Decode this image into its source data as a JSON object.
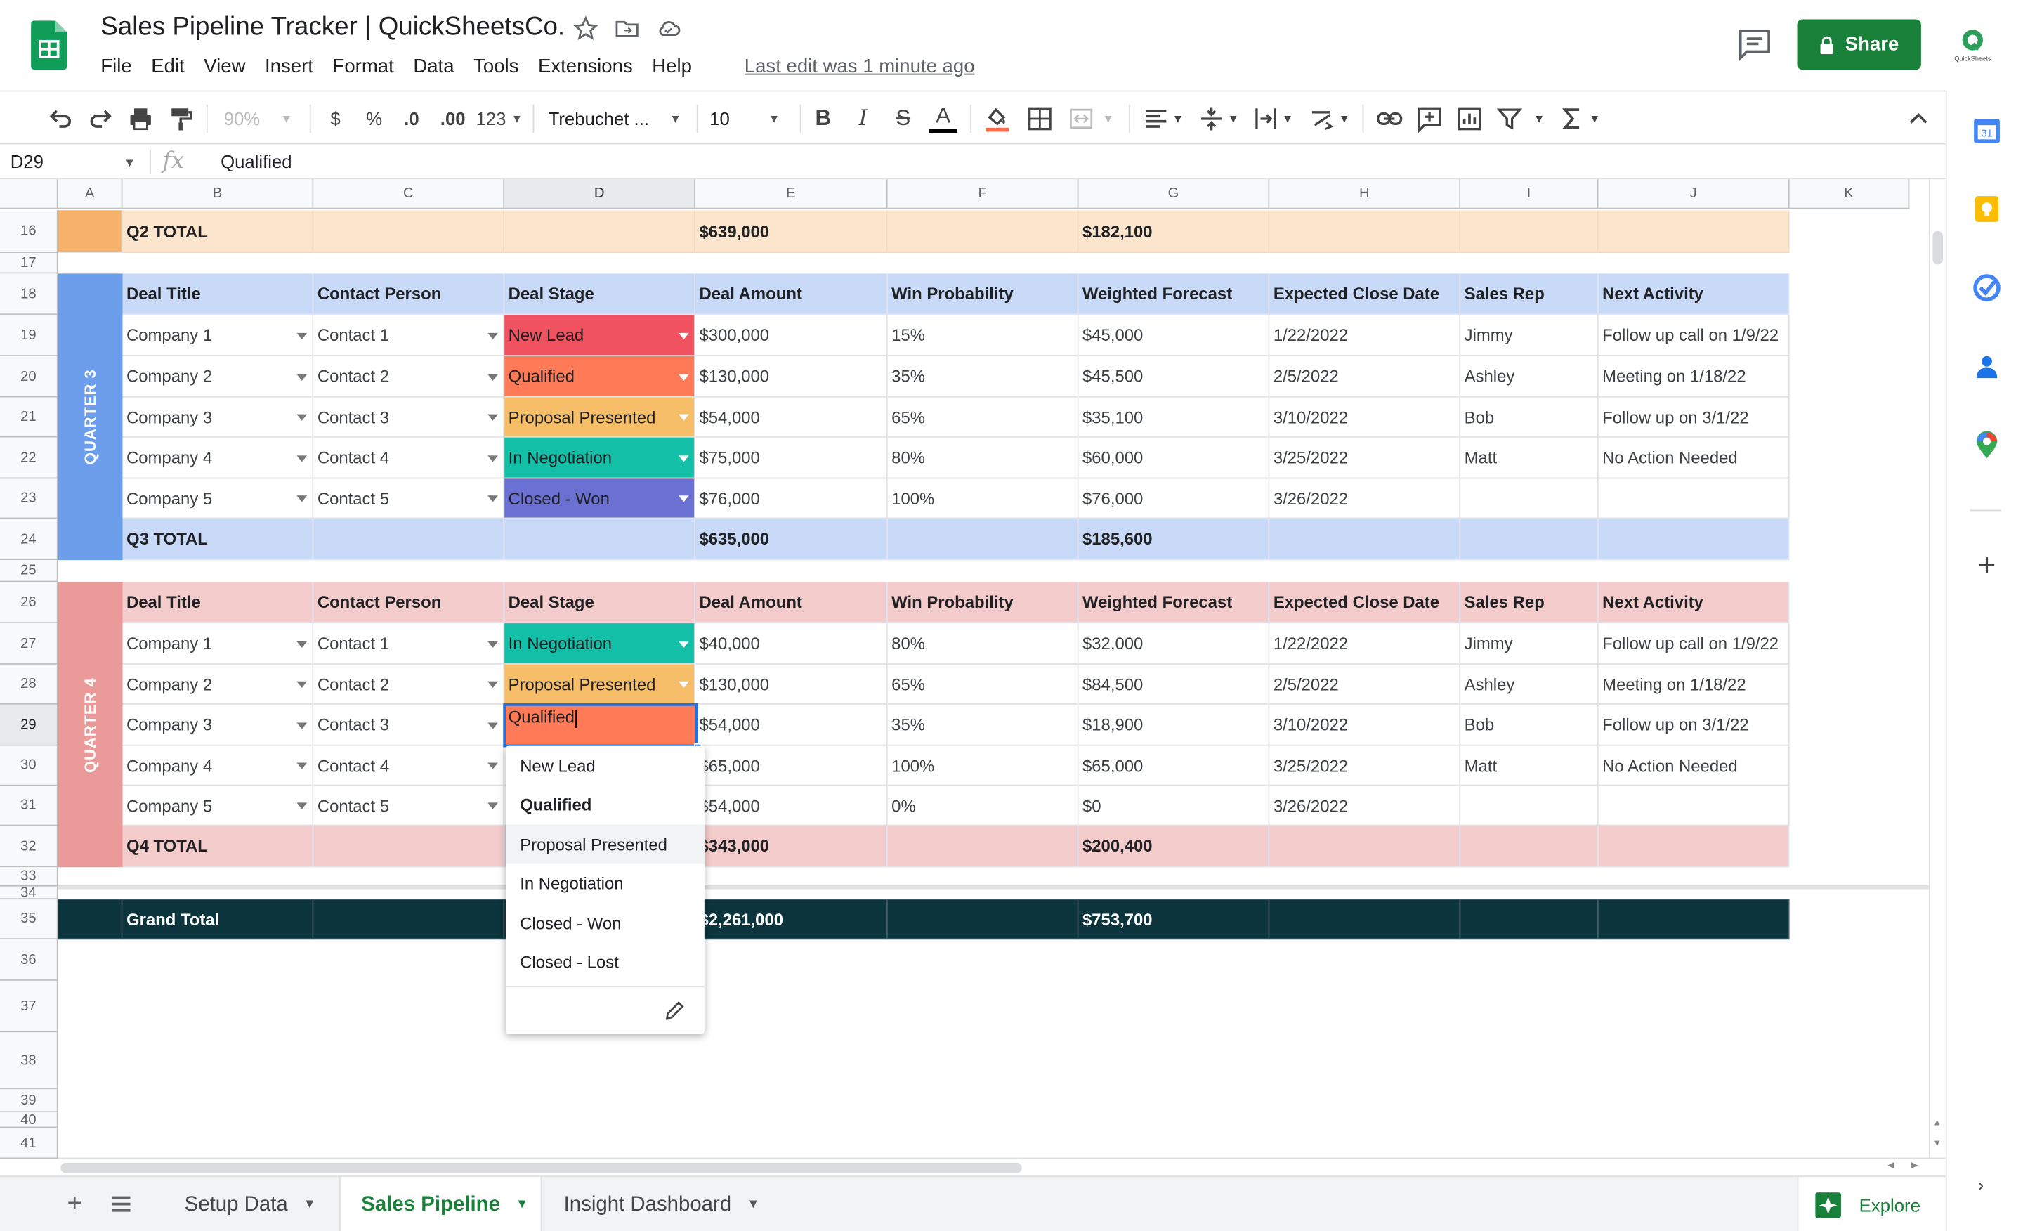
{
  "header": {
    "title": "Sales Pipeline Tracker | QuickSheetsCo.",
    "menu": [
      "File",
      "Edit",
      "View",
      "Insert",
      "Format",
      "Data",
      "Tools",
      "Extensions",
      "Help"
    ],
    "last_edit": "Last edit was 1 minute ago",
    "share_label": "Share",
    "avatar_text": "QuickSheets"
  },
  "toolbar": {
    "zoom": "90%",
    "currency": "$",
    "percent": "%",
    "dec_decrease": ".0",
    "dec_increase": ".00",
    "more_formats": "123",
    "font": "Trebuchet ...",
    "font_size": "10"
  },
  "formula_bar": {
    "cell_ref": "D29",
    "value": "Qualified"
  },
  "columns": [
    "A",
    "B",
    "C",
    "D",
    "E",
    "F",
    "G",
    "H",
    "I",
    "J",
    "K"
  ],
  "rows": [
    "16",
    "17",
    "18",
    "19",
    "20",
    "21",
    "22",
    "23",
    "24",
    "25",
    "26",
    "27",
    "28",
    "29",
    "30",
    "31",
    "32",
    "33",
    "34",
    "35",
    "36",
    "37",
    "38",
    "39",
    "40",
    "41"
  ],
  "headers": [
    "Deal Title",
    "Contact Person",
    "Deal Stage",
    "Deal Amount",
    "Win Probability",
    "Weighted Forecast",
    "Expected Close Date",
    "Sales Rep",
    "Next Activity"
  ],
  "q2_total": {
    "label": "Q2 TOTAL",
    "amount": "$639,000",
    "forecast": "$182,100"
  },
  "q3": {
    "band": "QUARTER 3",
    "rows": [
      [
        "Company 1",
        "Contact 1",
        "New Lead",
        "$300,000",
        "15%",
        "$45,000",
        "1/22/2022",
        "Jimmy",
        "Follow up call on 1/9/22"
      ],
      [
        "Company 2",
        "Contact 2",
        "Qualified",
        "$130,000",
        "35%",
        "$45,500",
        "2/5/2022",
        "Ashley",
        "Meeting on 1/18/22"
      ],
      [
        "Company 3",
        "Contact 3",
        "Proposal Presented",
        "$54,000",
        "65%",
        "$35,100",
        "3/10/2022",
        "Bob",
        "Follow up on 3/1/22"
      ],
      [
        "Company 4",
        "Contact 4",
        "In Negotiation",
        "$75,000",
        "80%",
        "$60,000",
        "3/25/2022",
        "Matt",
        "No Action Needed"
      ],
      [
        "Company 5",
        "Contact 5",
        "Closed - Won",
        "$76,000",
        "100%",
        "$76,000",
        "3/26/2022",
        "",
        ""
      ]
    ],
    "total": {
      "label": "Q3 TOTAL",
      "amount": "$635,000",
      "forecast": "$185,600"
    }
  },
  "q4": {
    "band": "QUARTER 4",
    "rows": [
      [
        "Company 1",
        "Contact 1",
        "In Negotiation",
        "$40,000",
        "80%",
        "$32,000",
        "1/22/2022",
        "Jimmy",
        "Follow up call on 1/9/22"
      ],
      [
        "Company 2",
        "Contact 2",
        "Proposal Presented",
        "$130,000",
        "65%",
        "$84,500",
        "2/5/2022",
        "Ashley",
        "Meeting on 1/18/22"
      ],
      [
        "Company 3",
        "Contact 3",
        "Qualified",
        "$54,000",
        "35%",
        "$18,900",
        "3/10/2022",
        "Bob",
        "Follow up on 3/1/22"
      ],
      [
        "Company 4",
        "Contact 4",
        "",
        "$65,000",
        "100%",
        "$65,000",
        "3/25/2022",
        "Matt",
        "No Action Needed"
      ],
      [
        "Company 5",
        "Contact 5",
        "",
        "$54,000",
        "0%",
        "$0",
        "3/26/2022",
        "",
        ""
      ]
    ],
    "total": {
      "label": "Q4 TOTAL",
      "amount": "$343,000",
      "forecast": "$200,400"
    }
  },
  "grand_total": {
    "label": "Grand Total",
    "amount": "$2,261,000",
    "forecast": "$753,700"
  },
  "stage_colors": {
    "New Lead": "#f0535f",
    "Qualified": "#ff7a57",
    "Proposal Presented": "#f6be69",
    "In Negotiation": "#13bfa6",
    "Closed - Won": "#6b71d3"
  },
  "dropdown": {
    "options": [
      "New Lead",
      "Qualified",
      "Proposal Presented",
      "In Negotiation",
      "Closed - Won",
      "Closed - Lost"
    ],
    "selected": "Qualified",
    "hovered": "Proposal Presented"
  },
  "sheet_tabs": [
    "Setup Data",
    "Sales Pipeline",
    "Insight Dashboard"
  ],
  "active_tab": "Sales Pipeline",
  "explore_label": "Explore",
  "colors": {
    "q2_fill": "#fce5cd",
    "q2_band": "#f6b26b",
    "q3_fill": "#c9daf8",
    "q3_band": "#6d9eeb",
    "q4_fill": "#f4cccc",
    "q4_band": "#ea9999",
    "grand_total_fill": "#0c343d",
    "share_green": "#188038"
  },
  "icons": {
    "side_panel": [
      "calendar-icon",
      "keep-icon",
      "tasks-icon",
      "contacts-icon",
      "maps-icon",
      "add-icon"
    ]
  }
}
